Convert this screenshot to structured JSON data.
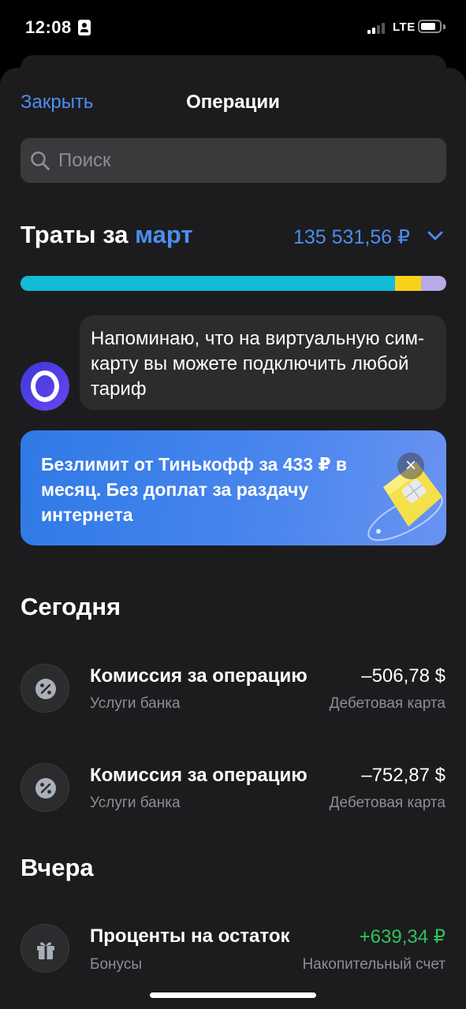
{
  "status_bar": {
    "time": "12:08",
    "network": "LTE",
    "signal_bars_active": 2,
    "battery_level": 0.7
  },
  "sheet": {
    "close_label": "Закрыть",
    "title": "Операции"
  },
  "search": {
    "placeholder": "Поиск",
    "icon": "search-icon"
  },
  "spending": {
    "title_prefix": "Траты за",
    "month": "март",
    "amount": "135 531,56 ₽",
    "bar_segments": [
      {
        "fraction": 0.88,
        "color": "#10bcd6"
      },
      {
        "fraction": 0.06,
        "color": "#f7d21a"
      },
      {
        "fraction": 0.06,
        "color": "#b9a9e6"
      }
    ]
  },
  "assistant": {
    "avatar_letter": "O",
    "message": "Напоминаю, что на виртуальную сим-карту вы можете подключить любой тариф"
  },
  "promo": {
    "text": "Безлимит от Тинькофф за 433 ₽ в месяц. Без доплат за раздачу интернета",
    "close_icon": "close-icon",
    "close_glyph": "×"
  },
  "groups": [
    {
      "title": "Сегодня",
      "items": [
        {
          "title": "Комиссия за операцию",
          "category": "Услуги банка",
          "amount": "–506,78 $",
          "account": "Дебетовая карта",
          "icon": "percent-icon"
        },
        {
          "title": "Комиссия за операцию",
          "category": "Услуги банка",
          "amount": "–752,87 $",
          "account": "Дебетовая карта",
          "icon": "percent-icon"
        }
      ]
    },
    {
      "title": "Вчера",
      "items": [
        {
          "title": "Проценты на остаток",
          "category": "Бонусы",
          "amount": "+639,34 ₽",
          "account": "Накопительный счет",
          "icon": "gift-icon",
          "amount_color": "#30c35b"
        }
      ]
    }
  ]
}
